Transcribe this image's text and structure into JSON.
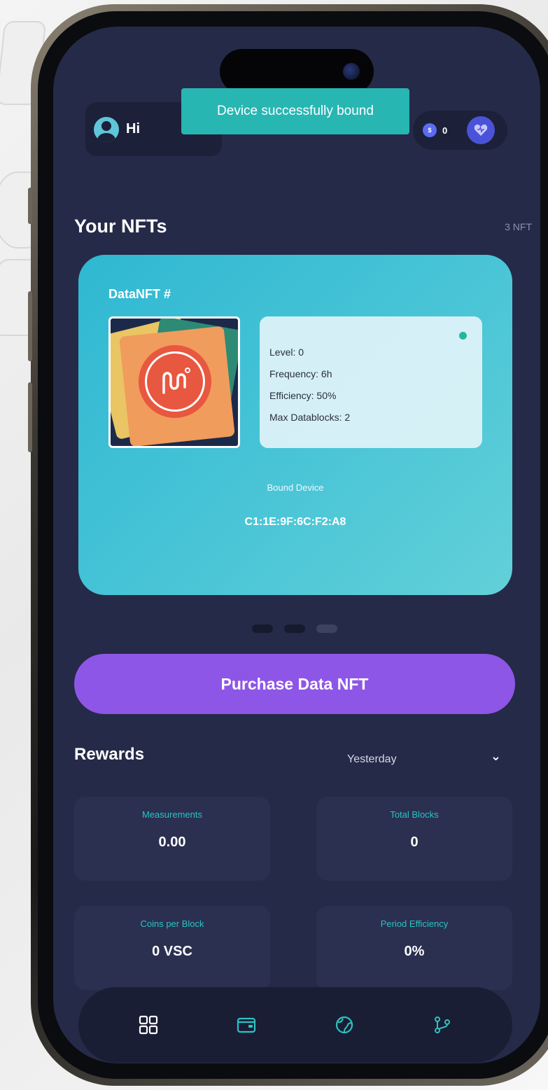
{
  "header": {
    "greeting": "Hi",
    "coin_count": "0",
    "coin_icon_label": "$",
    "heart_icon": "heart-icon"
  },
  "toast": {
    "message": "Device successfully bound"
  },
  "nfts": {
    "title": "Your NFTs",
    "count_label": "3 NFT",
    "card": {
      "name": "DataNFT #",
      "stats": [
        "Level: 0",
        "Frequency: 6h",
        "Efficiency: 50%",
        "Max Datablocks: 2"
      ],
      "bound_label": "Bound Device",
      "bound_device": "C1:1E:9F:6C:F2:A8"
    },
    "pagination": {
      "pages": 3,
      "current": 2
    }
  },
  "purchase_button": {
    "label": "Purchase Data NFT"
  },
  "rewards": {
    "title": "Rewards",
    "period": "Yesterday",
    "metrics": [
      {
        "label": "Measurements",
        "value": "0.00"
      },
      {
        "label": "Total Blocks",
        "value": "0"
      },
      {
        "label": "Coins per Block",
        "value": "0 VSC"
      },
      {
        "label": "Period Efficiency",
        "value": "0%"
      }
    ]
  },
  "tab_bar": {
    "tabs": [
      {
        "icon": "dashboard-icon",
        "active": true
      },
      {
        "icon": "wallet-icon",
        "active": false
      },
      {
        "icon": "globe-icon",
        "active": false
      },
      {
        "icon": "branch-icon",
        "active": false
      }
    ]
  },
  "colors": {
    "screen_bg": "#252a48",
    "accent_teal": "#2bc3c3",
    "purchase_purple": "#8e56e6",
    "card_cyan": "#2fb8d2",
    "toast_teal": "#27b6b2"
  }
}
